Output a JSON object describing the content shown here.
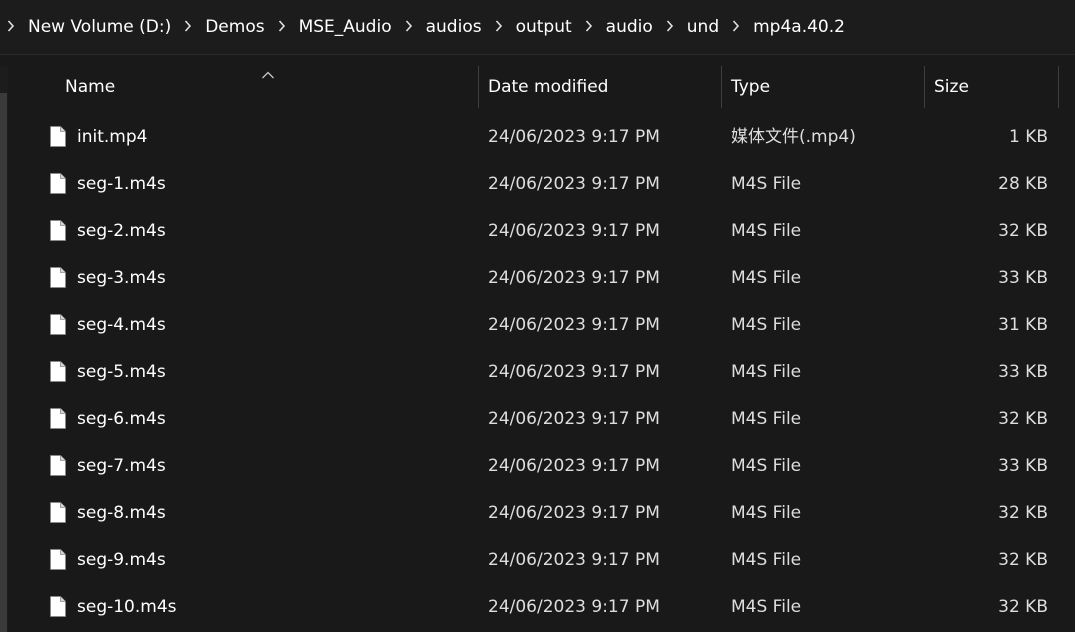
{
  "breadcrumb": {
    "items": [
      {
        "label": "New Volume (D:)"
      },
      {
        "label": "Demos"
      },
      {
        "label": "MSE_Audio"
      },
      {
        "label": "audios"
      },
      {
        "label": "output"
      },
      {
        "label": "audio"
      },
      {
        "label": "und"
      },
      {
        "label": "mp4a.40.2"
      }
    ]
  },
  "columns": {
    "name": "Name",
    "date": "Date modified",
    "type": "Type",
    "size": "Size",
    "sort_indicator": "^"
  },
  "files": [
    {
      "name": "init.mp4",
      "date": "24/06/2023 9:17 PM",
      "type": "媒体文件(.mp4)",
      "size": "1 KB",
      "icon": "file-icon"
    },
    {
      "name": "seg-1.m4s",
      "date": "24/06/2023 9:17 PM",
      "type": "M4S File",
      "size": "28 KB",
      "icon": "file-icon"
    },
    {
      "name": "seg-2.m4s",
      "date": "24/06/2023 9:17 PM",
      "type": "M4S File",
      "size": "32 KB",
      "icon": "file-icon"
    },
    {
      "name": "seg-3.m4s",
      "date": "24/06/2023 9:17 PM",
      "type": "M4S File",
      "size": "33 KB",
      "icon": "file-icon"
    },
    {
      "name": "seg-4.m4s",
      "date": "24/06/2023 9:17 PM",
      "type": "M4S File",
      "size": "31 KB",
      "icon": "file-icon"
    },
    {
      "name": "seg-5.m4s",
      "date": "24/06/2023 9:17 PM",
      "type": "M4S File",
      "size": "33 KB",
      "icon": "file-icon"
    },
    {
      "name": "seg-6.m4s",
      "date": "24/06/2023 9:17 PM",
      "type": "M4S File",
      "size": "32 KB",
      "icon": "file-icon"
    },
    {
      "name": "seg-7.m4s",
      "date": "24/06/2023 9:17 PM",
      "type": "M4S File",
      "size": "33 KB",
      "icon": "file-icon"
    },
    {
      "name": "seg-8.m4s",
      "date": "24/06/2023 9:17 PM",
      "type": "M4S File",
      "size": "32 KB",
      "icon": "file-icon"
    },
    {
      "name": "seg-9.m4s",
      "date": "24/06/2023 9:17 PM",
      "type": "M4S File",
      "size": "32 KB",
      "icon": "file-icon"
    },
    {
      "name": "seg-10.m4s",
      "date": "24/06/2023 9:17 PM",
      "type": "M4S File",
      "size": "32 KB",
      "icon": "file-icon"
    }
  ],
  "colors": {
    "background": "#191919",
    "text": "#ffffff",
    "divider": "#3e3e3e"
  }
}
